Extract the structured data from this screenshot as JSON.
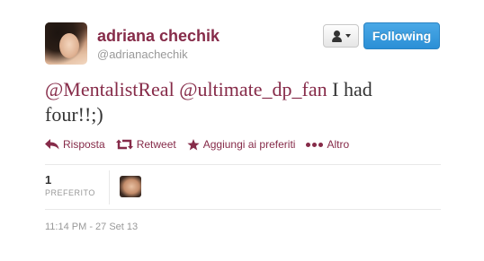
{
  "user": {
    "display_name": "adriana chechik",
    "screen_name": "@adrianachechik"
  },
  "header": {
    "user_menu_icon": "person-icon",
    "follow_label": "Following"
  },
  "tweet": {
    "mention_1": "@MentalistReal",
    "mention_2": "@ultimate_dp_fan",
    "text": " I had four!!;)"
  },
  "actions": {
    "reply": "Risposta",
    "retweet": "Retweet",
    "favorite": "Aggiungi ai preferiti",
    "more": "Altro"
  },
  "stats": {
    "count": "1",
    "label": "PREFERITO"
  },
  "timestamp": "11:14 PM - 27 Set 13",
  "colors": {
    "accent": "#862b49",
    "follow_button": "#2b8fd6",
    "muted": "#999999"
  }
}
